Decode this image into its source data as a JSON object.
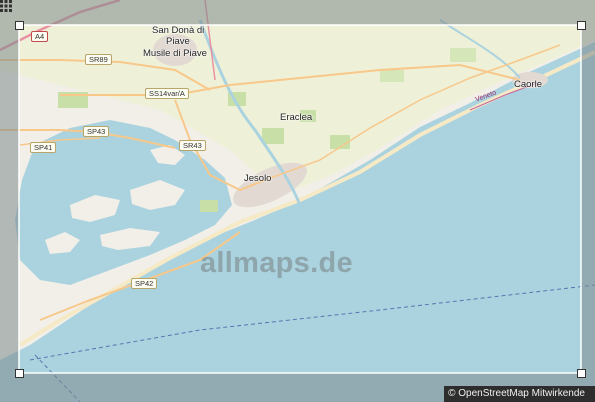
{
  "map": {
    "watermark": "allmaps.de",
    "attribution_symbol": "©",
    "attribution_text": "OpenStreetMap Mitwirkende",
    "places": {
      "san_dona": "San Donà di",
      "piave": "Piave",
      "musile": "Musile di Piave",
      "eraclea": "Eraclea",
      "jesolo": "Jesolo",
      "caorle": "Caorle"
    },
    "roads": {
      "a4": "A4",
      "sr89": "SR89",
      "ss14var": "SS14var/A",
      "sp43_left": "SP43",
      "sp41": "SP41",
      "sr43": "SR43",
      "sp42": "SP42",
      "veneto": "Veneto"
    },
    "colors": {
      "sea": "#aad3df",
      "land": "#f2efe9",
      "farmland": "#eef0d5",
      "green": "#c8e0a8",
      "outside_overlay": "#7d8a8c",
      "selection_border": "#ffffff"
    },
    "icons": {
      "layers": "grid-icon",
      "selection_handle": "square-handle"
    }
  }
}
